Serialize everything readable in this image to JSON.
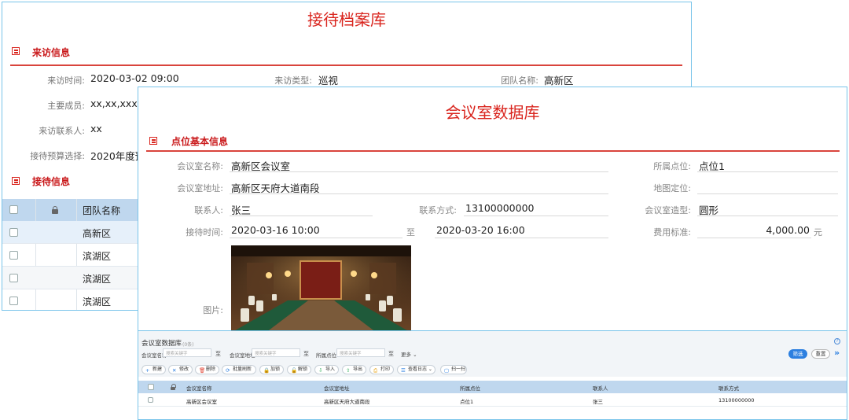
{
  "reception_panel": {
    "title": "接待档案库",
    "visit_section": {
      "title": "来访信息",
      "fields": {
        "visit_time": {
          "label": "来访时间:",
          "value": "2020-03-02 09:00"
        },
        "visit_type": {
          "label": "来访类型:",
          "value": "巡视"
        },
        "team_name": {
          "label": "团队名称:",
          "value": "高新区"
        },
        "members": {
          "label": "主要成员:",
          "value": "xx,xx,xxxx"
        },
        "contact": {
          "label": "来访联系人:",
          "value": "xx"
        },
        "budget": {
          "label": "接待预算选择:",
          "value": "2020年度预"
        }
      }
    },
    "reception_section": {
      "title": "接待信息",
      "table_header": {
        "team_col": "团队名称"
      },
      "rows": [
        "高新区",
        "滨湖区",
        "滨湖区",
        "滨湖区"
      ]
    }
  },
  "room_panel": {
    "title": "会议室数据库",
    "section_title": "点位基本信息",
    "fields": {
      "room_name": {
        "label": "会议室名称:",
        "value": "高新区会议室"
      },
      "location": {
        "label": "所属点位:",
        "value": "点位1"
      },
      "room_address": {
        "label": "会议室地址:",
        "value": "高新区天府大道南段"
      },
      "map_location": {
        "label": "地图定位:",
        "value": ""
      },
      "contact_person": {
        "label": "联系人:",
        "value": "张三"
      },
      "contact_phone": {
        "label": "联系方式:",
        "value": "13100000000"
      },
      "room_style": {
        "label": "会议室造型:",
        "value": "圆形"
      },
      "reception_time": {
        "label": "接待时间:",
        "start": "2020-03-16 10:00",
        "to": "至",
        "end": "2020-03-20 16:00"
      },
      "fee": {
        "label": "费用标准:",
        "value": "4,000.00",
        "unit": "元"
      },
      "photo": {
        "label": "图片:"
      }
    }
  },
  "room_list": {
    "title": "会议室数据库",
    "subtitle": "(0条)",
    "filters": [
      {
        "label": "会议室名称",
        "placeholder": "搜索关键字",
        "to": "至"
      },
      {
        "label": "会议室地址",
        "placeholder": "搜索关键字",
        "to": "至"
      },
      {
        "label": "所属点位",
        "placeholder": "搜索关键字",
        "to": "至"
      }
    ],
    "more_label": "更多",
    "filter_button": "筛选",
    "reset_button": "重置",
    "toolbar": [
      {
        "icon": "+",
        "label": "新建",
        "color": "#2c7fe0"
      },
      {
        "icon": "✕",
        "label": "修改",
        "color": "#2c7fe0"
      },
      {
        "icon": "🗑",
        "label": "删除",
        "color": "#e24a3b"
      },
      {
        "icon": "⟳",
        "label": "批量刷新",
        "color": "#2c7fe0"
      },
      {
        "icon": "🔒",
        "label": "加锁",
        "color": "#2c7fe0"
      },
      {
        "icon": "🔓",
        "label": "解锁",
        "color": "#2c7fe0"
      },
      {
        "icon": "⇩",
        "label": "导入",
        "color": "#2fae5a"
      },
      {
        "icon": "⇧",
        "label": "导出",
        "color": "#2fae5a"
      },
      {
        "icon": "⎙",
        "label": "打印",
        "color": "#e8a317"
      },
      {
        "icon": "☰",
        "label": "查看日志 ⌄",
        "color": "#2c7fe0"
      },
      {
        "icon": "▢",
        "label": "扫一扫",
        "color": "#2c7fe0"
      }
    ],
    "columns": [
      "会议室名称",
      "会议室地址",
      "所属点位",
      "联系人",
      "联系方式"
    ],
    "rows": [
      [
        "高新区会议室",
        "高新区天府大道南段",
        "点位1",
        "张三",
        "13100000000"
      ]
    ]
  }
}
